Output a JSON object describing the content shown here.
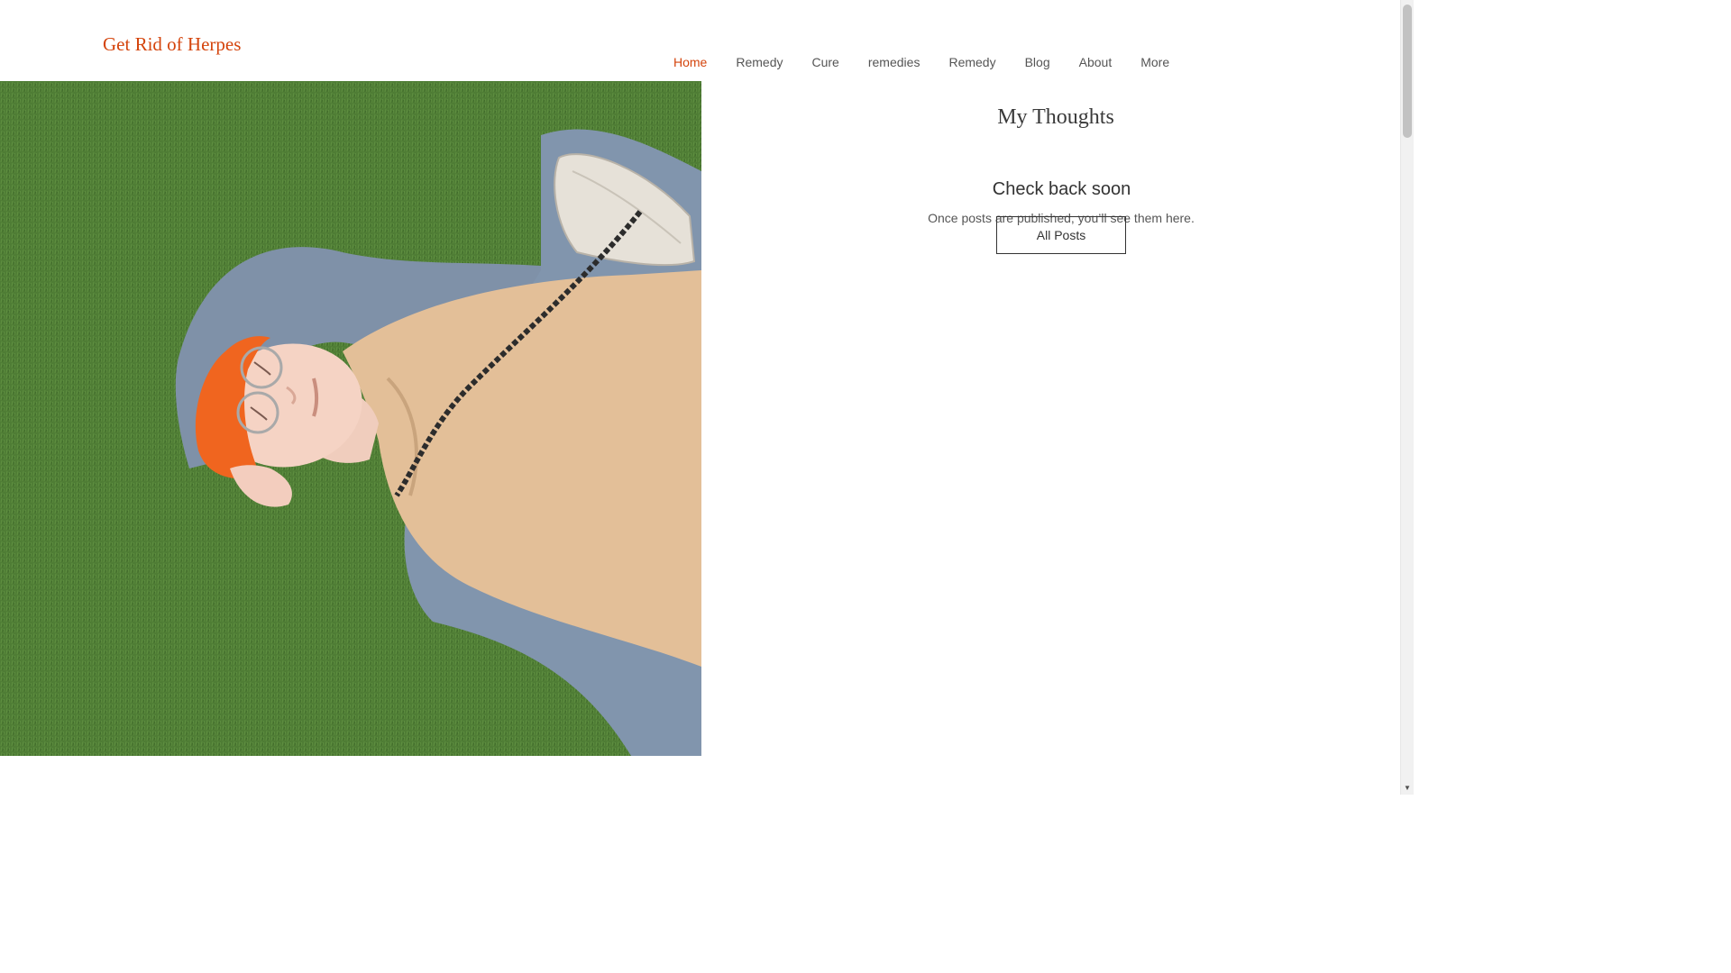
{
  "header": {
    "site_title": "Get Rid of Herpes",
    "nav_items": [
      "Home",
      "Remedy",
      "Cure",
      "remedies",
      "Remedy",
      "Blog",
      "About",
      "More"
    ],
    "active_item": "Home"
  },
  "hero": {
    "image": "photo-person-lying-on-grass"
  },
  "blog": {
    "title": "My Thoughts",
    "empty_heading": "Check back soon",
    "empty_text": "Once posts are published, you’ll see them here.",
    "all_posts_label": "All Posts"
  },
  "colors": {
    "accent": "#d4440c",
    "grass": "#4d7a34",
    "text": "#333333"
  }
}
